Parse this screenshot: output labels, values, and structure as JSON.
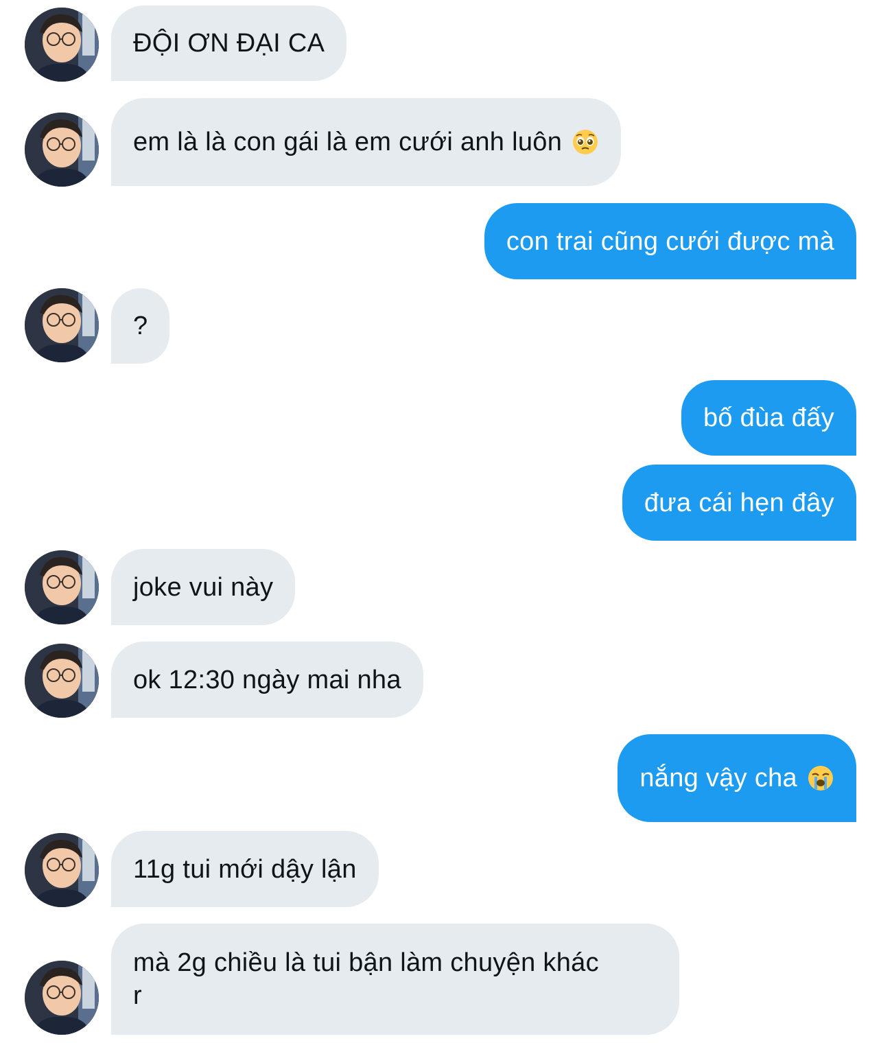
{
  "messages": [
    {
      "side": "in",
      "text": "ĐỘI ƠN ĐẠI CA"
    },
    {
      "side": "in",
      "text": "em là là con gái là em cưới anh luôn",
      "emoji": "pleading-face-emoji"
    },
    {
      "side": "out",
      "text": "con trai cũng cưới được mà"
    },
    {
      "side": "in",
      "text": "?"
    },
    {
      "side": "out",
      "text": "bố đùa đấy"
    },
    {
      "side": "out",
      "text": "đưa cái hẹn đây"
    },
    {
      "side": "in",
      "text": "joke vui này"
    },
    {
      "side": "in",
      "text": "ok 12:30 ngày mai nha"
    },
    {
      "side": "out",
      "text": "nắng vậy cha",
      "emoji": "loudly-crying-face-emoji"
    },
    {
      "side": "in",
      "text": "11g tui mới dậy lận"
    },
    {
      "side": "in",
      "text": "mà 2g chiều là tui bận làm chuyện khác r"
    }
  ],
  "colors": {
    "incoming_bubble": "#e6ebf0",
    "outgoing_bubble": "#1d9bf0",
    "incoming_text": "#0f1419",
    "outgoing_text": "#ffffff"
  }
}
